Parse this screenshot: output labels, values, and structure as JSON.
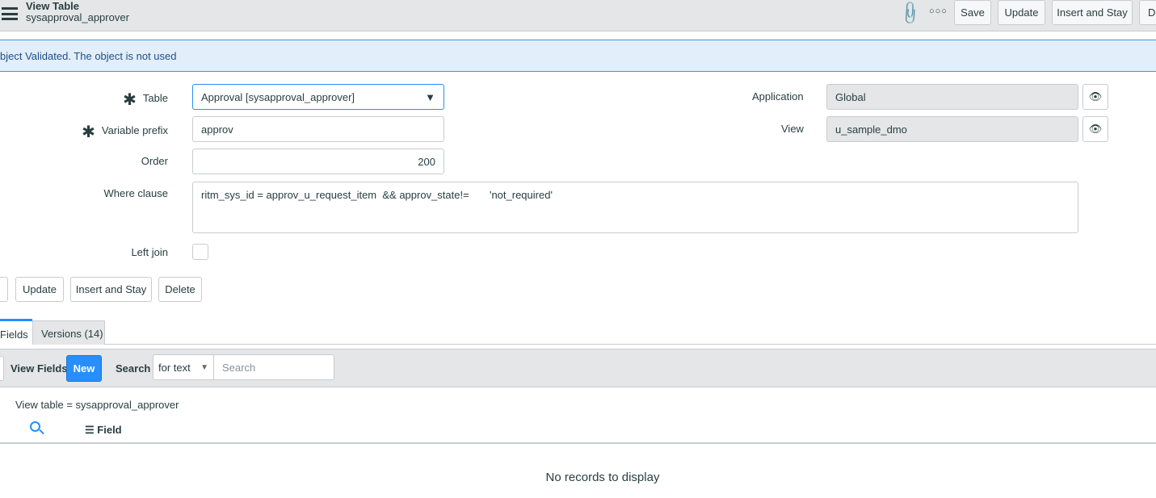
{
  "header": {
    "title": "View Table",
    "subtitle": "sysapproval_approver",
    "buttons": [
      "Save",
      "Update",
      "Insert and Stay",
      "De"
    ]
  },
  "banner": {
    "message": "bject Validated. The object is not used"
  },
  "form": {
    "table": {
      "label": "Table",
      "value": "Approval [sysapproval_approver]"
    },
    "prefix": {
      "label": "Variable prefix",
      "value": "approv"
    },
    "order": {
      "label": "Order",
      "value": "200"
    },
    "where": {
      "label": "Where clause",
      "value": "ritm_sys_id = approv_u_request_item  && approv_state!=       'not_required'"
    },
    "left_join": {
      "label": "Left join",
      "checked": false
    },
    "application": {
      "label": "Application",
      "value": "Global"
    },
    "view": {
      "label": "View",
      "value": "u_sample_dmo"
    }
  },
  "actions": [
    "Update",
    "Insert and Stay",
    "Delete"
  ],
  "tabs": [
    {
      "label": "Fields",
      "active": true
    },
    {
      "label": "Versions (14)",
      "active": false
    }
  ],
  "list": {
    "title": "View Fields",
    "new_label": "New",
    "search_label": "Search",
    "search_mode": "for text",
    "search_placeholder": "Search",
    "filter": "View table = sysapproval_approver",
    "column": "Field",
    "empty": "No records to display"
  },
  "colors": {
    "accent": "#278efc",
    "banner_bg": "#e2eef9"
  }
}
